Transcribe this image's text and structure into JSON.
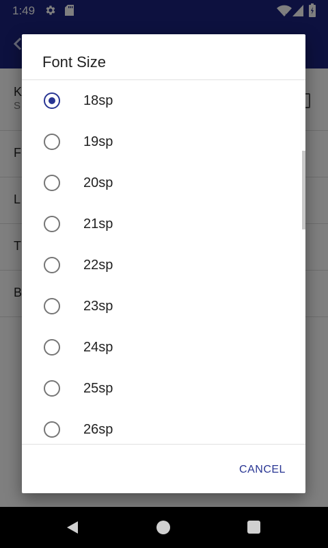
{
  "status_bar": {
    "time": "1:49",
    "icons": [
      "gear-icon",
      "sd-card-icon",
      "wifi-icon",
      "signal-icon",
      "battery-icon"
    ]
  },
  "background": {
    "rows": [
      {
        "letter": "K",
        "sub": "S"
      },
      {
        "letter": "F"
      },
      {
        "letter": "L"
      },
      {
        "letter": "T"
      },
      {
        "letter": "B"
      }
    ]
  },
  "dialog": {
    "title": "Font Size",
    "selected": "18sp",
    "options": [
      {
        "label": "18sp",
        "checked": true
      },
      {
        "label": "19sp",
        "checked": false
      },
      {
        "label": "20sp",
        "checked": false
      },
      {
        "label": "21sp",
        "checked": false
      },
      {
        "label": "22sp",
        "checked": false
      },
      {
        "label": "23sp",
        "checked": false
      },
      {
        "label": "24sp",
        "checked": false
      },
      {
        "label": "25sp",
        "checked": false
      },
      {
        "label": "26sp",
        "checked": false
      }
    ],
    "cancel_label": "CANCEL"
  },
  "colors": {
    "primary": "#1a237e",
    "accent": "#283593"
  },
  "nav_bar": {
    "icons": [
      "back-icon",
      "home-icon",
      "recents-icon"
    ]
  }
}
